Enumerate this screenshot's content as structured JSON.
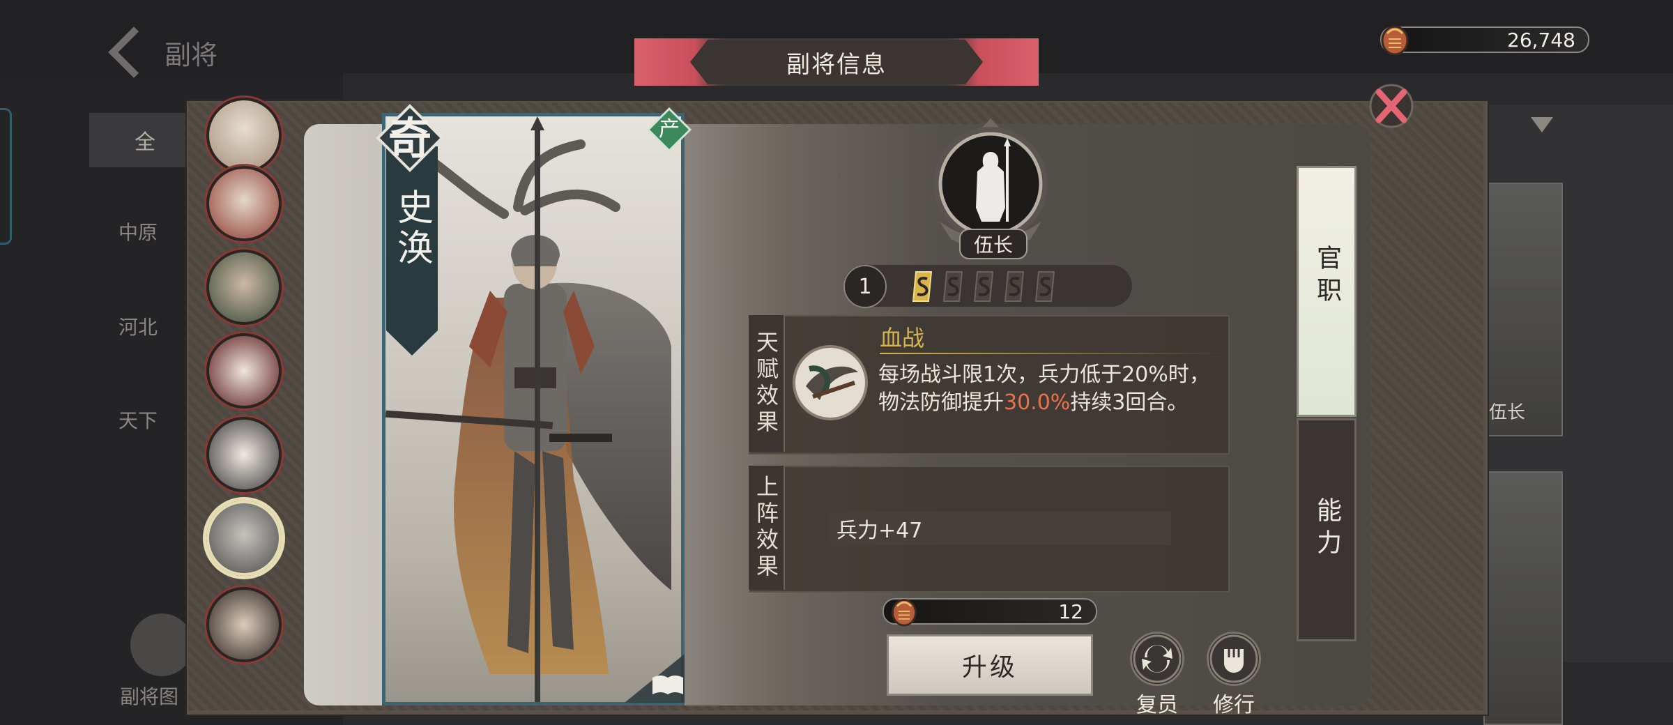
{
  "background": {
    "back_label": "副将",
    "categories": [
      "全",
      "中原",
      "河北",
      "天下"
    ],
    "album_label": "副将图",
    "card_rank_label": "伍长"
  },
  "currency": {
    "value": "26,748",
    "icon": "coin-bag-icon"
  },
  "title": "副将信息",
  "character": {
    "rarity": "奇",
    "name": "史涣",
    "faction": "产",
    "rank": "伍长",
    "level": "1",
    "stars_filled": 1,
    "stars_total": 5
  },
  "talent": {
    "label": "天赋效果",
    "name": "血战",
    "desc_part1": "每场战斗限1次，兵力低于20%时，物法防御提升",
    "desc_highlight": "30.0%",
    "desc_part2": "持续3回合。"
  },
  "deploy": {
    "label": "上阵效果",
    "stat": "兵力+47"
  },
  "upgrade": {
    "cost": "12",
    "button": "升级"
  },
  "actions": {
    "retire": "复员",
    "train": "修行"
  },
  "tabs": {
    "rank": "官职",
    "ability": "能力"
  },
  "colors": {
    "accent_red": "#d9616c",
    "highlight": "#e8734d",
    "talent_gold": "#d6b54d",
    "card_border": "#3d6470"
  }
}
